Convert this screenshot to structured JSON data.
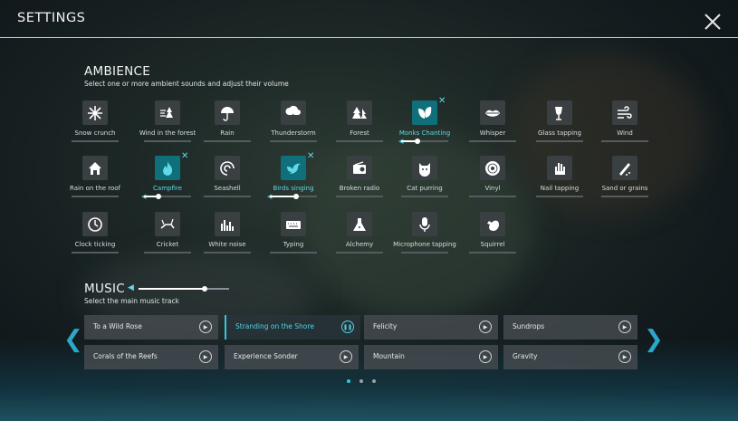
{
  "header": {
    "title": "SETTINGS",
    "close_icon": "close-icon"
  },
  "ambience": {
    "title": "AMBIENCE",
    "subtitle": "Select one or more ambient sounds and adjust their volume",
    "items": [
      {
        "label": "Snow crunch",
        "icon": "snowflake-icon",
        "active": false
      },
      {
        "label": "Wind in the forest",
        "icon": "forest-wind-icon",
        "active": false
      },
      {
        "label": "Rain",
        "icon": "umbrella-rain-icon",
        "active": false
      },
      {
        "label": "Thunderstorm",
        "icon": "storm-cloud-icon",
        "active": false
      },
      {
        "label": "Forest",
        "icon": "pine-trees-icon",
        "active": false
      },
      {
        "label": "Monks Chanting",
        "icon": "leaves-icon",
        "active": true,
        "volume": 0.35
      },
      {
        "label": "Whisper",
        "icon": "lips-icon",
        "active": false
      },
      {
        "label": "Glass tapping",
        "icon": "wine-glass-icon",
        "active": false
      },
      {
        "label": "Wind",
        "icon": "wind-icon",
        "active": false
      },
      {
        "label": "Rain on the roof",
        "icon": "house-icon",
        "active": false
      },
      {
        "label": "Campfire",
        "icon": "flame-icon",
        "active": true,
        "volume": 0.3
      },
      {
        "label": "Seashell",
        "icon": "seashell-icon",
        "active": false
      },
      {
        "label": "Birds singing",
        "icon": "bird-icon",
        "active": true,
        "volume": 0.55
      },
      {
        "label": "Broken radio",
        "icon": "radio-icon",
        "active": false
      },
      {
        "label": "Cat purring",
        "icon": "cat-icon",
        "active": false
      },
      {
        "label": "Vinyl",
        "icon": "vinyl-icon",
        "active": false
      },
      {
        "label": "Nail tapping",
        "icon": "hand-icon",
        "active": false
      },
      {
        "label": "Sand or grains",
        "icon": "sand-icon",
        "active": false
      },
      {
        "label": "Clock ticking",
        "icon": "clock-icon",
        "active": false
      },
      {
        "label": "Cricket",
        "icon": "cricket-icon",
        "active": false
      },
      {
        "label": "White noise",
        "icon": "equalizer-icon",
        "active": false
      },
      {
        "label": "Typing",
        "icon": "keyboard-icon",
        "active": false
      },
      {
        "label": "Alchemy",
        "icon": "flask-icon",
        "active": false
      },
      {
        "label": "Microphone tapping",
        "icon": "microphone-icon",
        "active": false
      },
      {
        "label": "Squirrel",
        "icon": "squirrel-icon",
        "active": false
      }
    ]
  },
  "music": {
    "title": "MUSIC",
    "subtitle": "Select the main music track",
    "volume": 0.73,
    "tracks": [
      {
        "name": "To a Wild Rose",
        "state": "play"
      },
      {
        "name": "Stranding on the Shore",
        "state": "pause"
      },
      {
        "name": "Felicity",
        "state": "play"
      },
      {
        "name": "Sundrops",
        "state": "play"
      },
      {
        "name": "Corals of the Reefs",
        "state": "play"
      },
      {
        "name": "Experience Sonder",
        "state": "play"
      },
      {
        "name": "Mountain",
        "state": "play"
      },
      {
        "name": "Gravity",
        "state": "play"
      }
    ],
    "play_glyph": "▶",
    "pause_glyph": "❚❚",
    "prev_glyph": "❮",
    "next_glyph": "❯",
    "pages": 3,
    "current_page": 1
  },
  "colors": {
    "accent": "#36c7de",
    "tile": "#3a3f42",
    "active_tile": "#0f6f7a"
  }
}
